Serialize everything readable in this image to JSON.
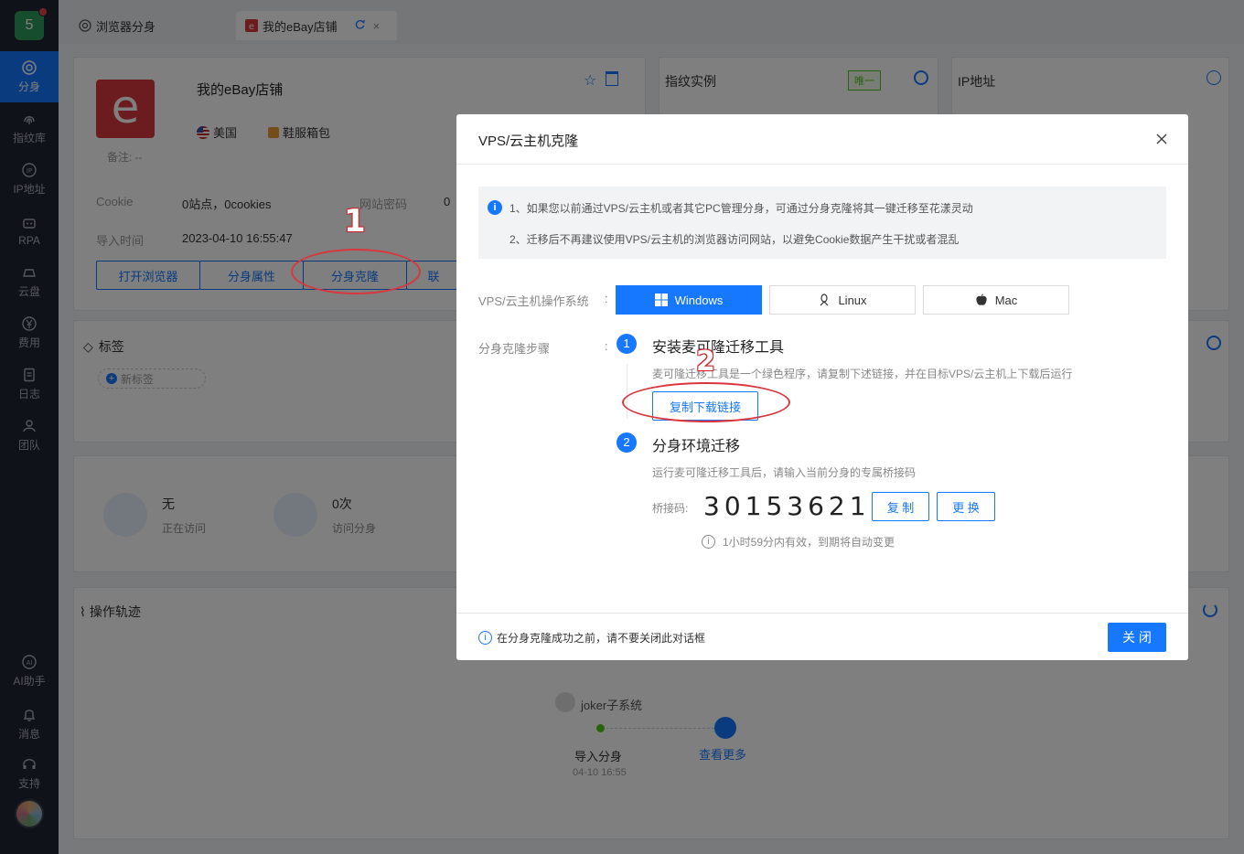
{
  "sidebar": {
    "logo_text": "5",
    "items": [
      {
        "label": "分身",
        "icon": "chrome-icon"
      },
      {
        "label": "指纹库",
        "icon": "fingerprint-icon"
      },
      {
        "label": "IP地址",
        "icon": "ip-icon"
      },
      {
        "label": "RPA",
        "icon": "robot-icon"
      },
      {
        "label": "云盘",
        "icon": "cloud-icon"
      },
      {
        "label": "费用",
        "icon": "yen-icon"
      },
      {
        "label": "日志",
        "icon": "document-icon"
      },
      {
        "label": "团队",
        "icon": "team-icon"
      },
      {
        "label": "AI助手",
        "icon": "ai-icon"
      },
      {
        "label": "消息",
        "icon": "bell-icon"
      },
      {
        "label": "支持",
        "icon": "headset-icon"
      }
    ]
  },
  "tabs": [
    {
      "label": "浏览器分身"
    },
    {
      "label": "我的eBay店铺"
    }
  ],
  "profile": {
    "logo_letter": "e",
    "name": "我的eBay店铺",
    "country": "美国",
    "category": "鞋服箱包",
    "note": "备注: --",
    "cookie_label": "Cookie",
    "cookie_value": "0站点，0cookies",
    "pwd_label": "网站密码",
    "pwd_value": "0",
    "import_label": "导入时间",
    "import_value": "2023-04-10 16:55:47",
    "buttons": {
      "open": "打开浏览器",
      "props": "分身属性",
      "clone": "分身克隆",
      "more": "联"
    }
  },
  "fingerprint": {
    "title": "指纹实例",
    "badge": "唯一"
  },
  "ip": {
    "title": "IP地址"
  },
  "tags": {
    "title": "标签",
    "new_tag": "新标签"
  },
  "stats": [
    {
      "value": "无",
      "label": "正在访问"
    },
    {
      "value": "0次",
      "label": "访问分身"
    }
  ],
  "track": {
    "title": "操作轨迹",
    "user": "joker子系统",
    "event": "导入分身",
    "event_time": "04-10 16:55",
    "more": "查看更多"
  },
  "modal": {
    "title": "VPS/云主机克隆",
    "info1": "1、如果您以前通过VPS/云主机或者其它PC管理分身，可通过分身克隆将其一键迁移至花漾灵动",
    "info2": "2、迁移后不再建议使用VPS/云主机的浏览器访问网站，以避免Cookie数据产生干扰或者混乱",
    "os_label": "VPS/云主机操作系统",
    "os_options": [
      "Windows",
      "Linux",
      "Mac"
    ],
    "steps_label": "分身克隆步骤",
    "colon": ":",
    "step1": {
      "num": "1",
      "title": "安装麦可隆迁移工具",
      "desc": "麦可隆迁移工具是一个绿色程序，请复制下述链接，并在目标VPS/云主机上下载后运行",
      "button": "复制下载链接"
    },
    "step2": {
      "num": "2",
      "title": "分身环境迁移",
      "desc": "运行麦可隆迁移工具后，请输入当前分身的专属桥接码"
    },
    "bridge_label": "桥接码:",
    "bridge_code": "30153621",
    "copy_btn": "复 制",
    "change_btn": "更 换",
    "validity": "1小时59分内有效，到期将自动变更",
    "footer_note": "在分身克隆成功之前，请不要关闭此对话框",
    "close_btn": "关 闭"
  },
  "annotations": [
    "1",
    "2"
  ],
  "colors": {
    "accent": "#1677ff",
    "sidebar_bg": "#1f2430",
    "annotation": "#d9363e"
  }
}
